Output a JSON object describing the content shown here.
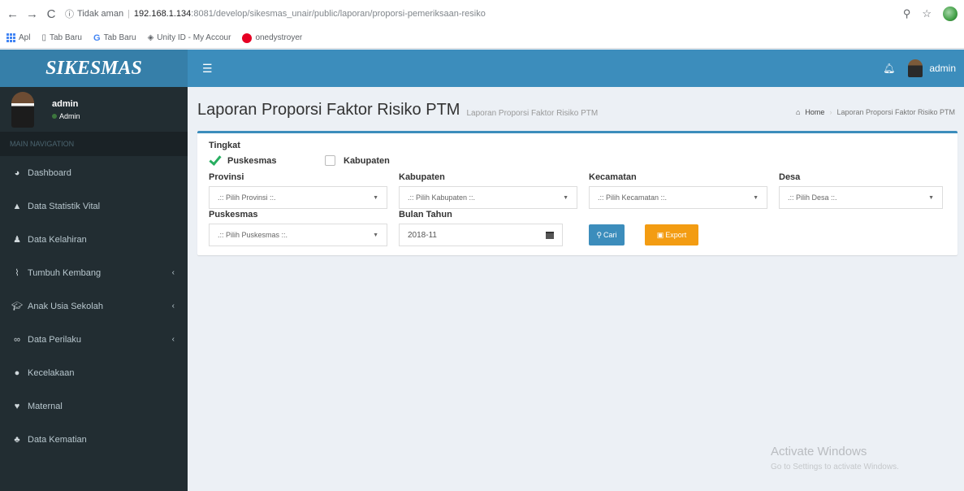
{
  "browser": {
    "url_security": "Tidak aman",
    "url_host": "192.168.1.134",
    "url_path": ":8081/develop/sikesmas_unair/public/laporan/proporsi-pemeriksaan-resiko",
    "bookmarks": [
      "Apl",
      "Tab Baru",
      "Tab Baru",
      "Unity ID - My Accour",
      "onedystroyer"
    ]
  },
  "app": {
    "logo": "SIKESMAS",
    "user_name": "admin"
  },
  "sidebar": {
    "user_name": "admin",
    "user_role": "Admin",
    "nav_header": "MAIN NAVIGATION",
    "items": [
      {
        "label": "Dashboard",
        "icon": "dashboard-icon"
      },
      {
        "label": "Data Statistik Vital",
        "icon": "user-icon"
      },
      {
        "label": "Data Kelahiran",
        "icon": "child-icon"
      },
      {
        "label": "Tumbuh Kembang",
        "icon": "line-chart-icon"
      },
      {
        "label": "Anak Usia Sekolah",
        "icon": "graduation-cap-icon"
      },
      {
        "label": "Data Perilaku",
        "icon": "binoculars-icon"
      },
      {
        "label": "Kecelakaan",
        "icon": "exclamation-icon"
      },
      {
        "label": "Maternal",
        "icon": "heartbeat-icon"
      },
      {
        "label": "Data Kematian",
        "icon": "users-icon"
      }
    ]
  },
  "header": {
    "title": "Laporan Proporsi Faktor Risiko PTM",
    "subtitle": "Laporan Proporsi Faktor Risiko PTM",
    "breadcrumb_home": "Home",
    "breadcrumb_current": "Laporan Proporsi Faktor Risiko PTM"
  },
  "form": {
    "tingkat_label": "Tingkat",
    "opt_puskesmas": "Puskesmas",
    "opt_kabupaten": "Kabupaten",
    "provinsi_label": "Provinsi",
    "provinsi_placeholder": ".:: Pilih Provinsi ::.",
    "kabupaten_label": "Kabupaten",
    "kabupaten_placeholder": ".:: Pilih Kabupaten ::.",
    "kecamatan_label": "Kecamatan",
    "kecamatan_placeholder": ".:: Pilih Kecamatan ::.",
    "desa_label": "Desa",
    "desa_placeholder": ".:: Pilih Desa ::.",
    "puskesmas_label": "Puskesmas",
    "puskesmas_placeholder": ".:: Pilih Puskesmas ::.",
    "bulan_label": "Bulan Tahun",
    "bulan_value": "2018-11",
    "cari_label": "Cari",
    "export_label": "Export"
  },
  "watermark": {
    "line1": "Activate Windows",
    "line2": "Go to Settings to activate Windows."
  }
}
